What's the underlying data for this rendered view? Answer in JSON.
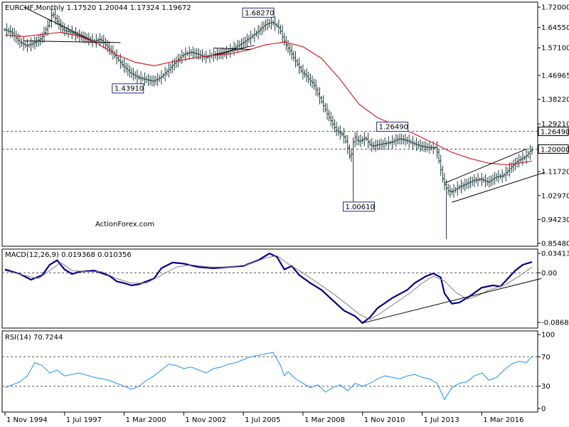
{
  "chart_data": [
    {
      "type": "ohlc",
      "title": "EURCHF,Monthly  1.17520 1.20044 1.17324 1.19672",
      "watermark": "ActionForex.com",
      "ylim": [
        0.8441,
        1.7382
      ],
      "y_ticks": [
        "1.72000",
        "1.64550",
        "1.57100",
        "1.46965",
        "1.38220",
        "1.29210",
        "1.20000",
        "1.11720",
        "1.02970",
        "0.94230",
        "0.85480"
      ],
      "y_tick_values": [
        1.72,
        1.6455,
        1.571,
        1.46965,
        1.3822,
        1.2921,
        1.2,
        1.1172,
        1.0297,
        0.9423,
        0.8548
      ],
      "price_axis_labels": [
        "1.26490",
        "1.20000"
      ],
      "x_ticks": [
        "1 Nov 1994",
        "1 Jul 1997",
        "1 Mar 2000",
        "1 Nov 2002",
        "1 Jul 2005",
        "1 Mar 2008",
        "1 Nov 2010",
        "1 Jul 2013",
        "1 Mar 2016"
      ],
      "x_tick_index": [
        0,
        32,
        64,
        96,
        128,
        160,
        192,
        224,
        256
      ],
      "n_bars": 284,
      "price_series": [
        [
          0,
          1.638
        ],
        [
          4,
          1.628
        ],
        [
          8,
          1.594
        ],
        [
          12,
          1.578
        ],
        [
          16,
          1.588
        ],
        [
          20,
          1.606
        ],
        [
          24,
          1.658
        ],
        [
          26,
          1.7
        ],
        [
          28,
          1.672
        ],
        [
          32,
          1.635
        ],
        [
          36,
          1.628
        ],
        [
          40,
          1.615
        ],
        [
          44,
          1.606
        ],
        [
          48,
          1.595
        ],
        [
          52,
          1.602
        ],
        [
          56,
          1.57
        ],
        [
          60,
          1.538
        ],
        [
          64,
          1.505
        ],
        [
          68,
          1.478
        ],
        [
          72,
          1.462
        ],
        [
          76,
          1.455
        ],
        [
          80,
          1.448
        ],
        [
          84,
          1.462
        ],
        [
          88,
          1.488
        ],
        [
          92,
          1.518
        ],
        [
          96,
          1.545
        ],
        [
          100,
          1.555
        ],
        [
          104,
          1.548
        ],
        [
          108,
          1.536
        ],
        [
          112,
          1.544
        ],
        [
          116,
          1.548
        ],
        [
          120,
          1.556
        ],
        [
          124,
          1.572
        ],
        [
          128,
          1.588
        ],
        [
          132,
          1.608
        ],
        [
          136,
          1.628
        ],
        [
          140,
          1.655
        ],
        [
          144,
          1.665
        ],
        [
          148,
          1.642
        ],
        [
          150,
          1.6
        ],
        [
          152,
          1.575
        ],
        [
          154,
          1.555
        ],
        [
          156,
          1.528
        ],
        [
          158,
          1.505
        ],
        [
          160,
          1.48
        ],
        [
          162,
          1.472
        ],
        [
          164,
          1.452
        ],
        [
          166,
          1.44
        ],
        [
          168,
          1.41
        ],
        [
          170,
          1.38
        ],
        [
          172,
          1.352
        ],
        [
          174,
          1.322
        ],
        [
          176,
          1.298
        ],
        [
          178,
          1.272
        ],
        [
          180,
          1.26
        ],
        [
          182,
          1.252
        ],
        [
          184,
          1.22
        ],
        [
          186,
          1.16
        ],
        [
          188,
          1.248
        ],
        [
          190,
          1.228
        ],
        [
          192,
          1.232
        ],
        [
          194,
          1.242
        ],
        [
          196,
          1.22
        ],
        [
          198,
          1.21
        ],
        [
          200,
          1.215
        ],
        [
          204,
          1.22
        ],
        [
          208,
          1.225
        ],
        [
          212,
          1.238
        ],
        [
          216,
          1.232
        ],
        [
          220,
          1.22
        ],
        [
          224,
          1.21
        ],
        [
          228,
          1.206
        ],
        [
          232,
          1.205
        ],
        [
          236,
          1.076
        ],
        [
          238,
          1.05
        ],
        [
          240,
          1.042
        ],
        [
          244,
          1.06
        ],
        [
          248,
          1.072
        ],
        [
          252,
          1.085
        ],
        [
          256,
          1.09
        ],
        [
          260,
          1.078
        ],
        [
          264,
          1.098
        ],
        [
          268,
          1.102
        ],
        [
          272,
          1.132
        ],
        [
          276,
          1.158
        ],
        [
          280,
          1.172
        ],
        [
          283,
          1.1967
        ]
      ],
      "moving_average": [
        [
          0,
          1.618
        ],
        [
          10,
          1.612
        ],
        [
          20,
          1.62
        ],
        [
          30,
          1.628
        ],
        [
          40,
          1.613
        ],
        [
          50,
          1.585
        ],
        [
          60,
          1.545
        ],
        [
          70,
          1.518
        ],
        [
          80,
          1.505
        ],
        [
          90,
          1.52
        ],
        [
          100,
          1.532
        ],
        [
          110,
          1.542
        ],
        [
          120,
          1.548
        ],
        [
          130,
          1.562
        ],
        [
          140,
          1.582
        ],
        [
          150,
          1.592
        ],
        [
          160,
          1.575
        ],
        [
          170,
          1.532
        ],
        [
          180,
          1.455
        ],
        [
          190,
          1.365
        ],
        [
          200,
          1.315
        ],
        [
          210,
          1.286
        ],
        [
          220,
          1.255
        ],
        [
          230,
          1.222
        ],
        [
          240,
          1.188
        ],
        [
          250,
          1.165
        ],
        [
          260,
          1.148
        ],
        [
          270,
          1.142
        ],
        [
          283,
          1.156
        ]
      ],
      "horizontal_lines": [
        1.2649,
        1.2
      ],
      "annotations": [
        {
          "text": "1.68270",
          "index": 136,
          "value": 1.6827
        },
        {
          "text": "1.43910",
          "index": 66,
          "value": 1.4391
        },
        {
          "text": "1.26490",
          "index": 208,
          "value": 1.2649
        },
        {
          "text": "1.00610",
          "index": 190,
          "value": 1.0061
        }
      ]
    },
    {
      "type": "line",
      "title": "MACD(12,26,9) 0.019368 0.010356",
      "ylim": [
        -0.0968,
        0.0416
      ],
      "y_ticks": [
        "0.034137",
        "0.00",
        "-0.086849"
      ],
      "y_tick_values": [
        0.034137,
        0.0,
        -0.086849
      ],
      "series": [
        {
          "name": "MACD",
          "color": "#00008b",
          "points": [
            [
              0,
              0.006
            ],
            [
              8,
              -0.002
            ],
            [
              14,
              -0.012
            ],
            [
              20,
              -0.004
            ],
            [
              24,
              0.014
            ],
            [
              28,
              0.022
            ],
            [
              32,
              0.006
            ],
            [
              36,
              -0.002
            ],
            [
              40,
              0.002
            ],
            [
              48,
              0.004
            ],
            [
              56,
              -0.005
            ],
            [
              60,
              -0.015
            ],
            [
              64,
              -0.018
            ],
            [
              68,
              -0.022
            ],
            [
              72,
              -0.02
            ],
            [
              80,
              -0.01
            ],
            [
              84,
              0.008
            ],
            [
              90,
              0.018
            ],
            [
              96,
              0.016
            ],
            [
              104,
              0.01
            ],
            [
              112,
              0.008
            ],
            [
              120,
              0.01
            ],
            [
              128,
              0.012
            ],
            [
              136,
              0.022
            ],
            [
              142,
              0.034
            ],
            [
              146,
              0.028
            ],
            [
              150,
              0.006
            ],
            [
              154,
              0.012
            ],
            [
              158,
              -0.004
            ],
            [
              164,
              -0.018
            ],
            [
              170,
              -0.03
            ],
            [
              176,
              -0.048
            ],
            [
              182,
              -0.066
            ],
            [
              188,
              -0.076
            ],
            [
              192,
              -0.088
            ],
            [
              196,
              -0.078
            ],
            [
              200,
              -0.062
            ],
            [
              208,
              -0.044
            ],
            [
              216,
              -0.03
            ],
            [
              220,
              -0.018
            ],
            [
              226,
              -0.006
            ],
            [
              230,
              -0.001
            ],
            [
              234,
              -0.008
            ],
            [
              236,
              -0.036
            ],
            [
              240,
              -0.054
            ],
            [
              244,
              -0.052
            ],
            [
              250,
              -0.04
            ],
            [
              256,
              -0.026
            ],
            [
              262,
              -0.022
            ],
            [
              266,
              -0.024
            ],
            [
              270,
              -0.01
            ],
            [
              274,
              0.004
            ],
            [
              278,
              0.014
            ],
            [
              283,
              0.019
            ]
          ]
        },
        {
          "name": "Signal",
          "color": "#808080",
          "points": [
            [
              0,
              0.004
            ],
            [
              10,
              -0.004
            ],
            [
              18,
              -0.01
            ],
            [
              24,
              0.004
            ],
            [
              30,
              0.018
            ],
            [
              36,
              0.004
            ],
            [
              44,
              0.002
            ],
            [
              52,
              0.002
            ],
            [
              60,
              -0.01
            ],
            [
              68,
              -0.018
            ],
            [
              76,
              -0.018
            ],
            [
              84,
              -0.004
            ],
            [
              92,
              0.01
            ],
            [
              100,
              0.014
            ],
            [
              110,
              0.01
            ],
            [
              120,
              0.01
            ],
            [
              130,
              0.014
            ],
            [
              140,
              0.026
            ],
            [
              146,
              0.03
            ],
            [
              152,
              0.016
            ],
            [
              160,
              0.0
            ],
            [
              168,
              -0.018
            ],
            [
              176,
              -0.036
            ],
            [
              184,
              -0.056
            ],
            [
              190,
              -0.072
            ],
            [
              196,
              -0.082
            ],
            [
              202,
              -0.07
            ],
            [
              210,
              -0.052
            ],
            [
              218,
              -0.034
            ],
            [
              224,
              -0.018
            ],
            [
              230,
              -0.006
            ],
            [
              236,
              -0.014
            ],
            [
              242,
              -0.034
            ],
            [
              248,
              -0.046
            ],
            [
              254,
              -0.04
            ],
            [
              260,
              -0.03
            ],
            [
              268,
              -0.022
            ],
            [
              276,
              -0.006
            ],
            [
              283,
              0.01
            ]
          ]
        }
      ],
      "horizontal_lines": [
        0
      ]
    },
    {
      "type": "line",
      "title": "RSI(14) 70.7244",
      "ylim": [
        -5,
        105
      ],
      "y_ticks": [
        "100",
        "70",
        "30",
        "0"
      ],
      "y_tick_values": [
        100,
        70,
        30,
        0
      ],
      "series": [
        {
          "name": "RSI",
          "color": "#1e90ff",
          "points": [
            [
              0,
              28
            ],
            [
              4,
              32
            ],
            [
              8,
              36
            ],
            [
              12,
              44
            ],
            [
              16,
              62
            ],
            [
              20,
              58
            ],
            [
              24,
              48
            ],
            [
              28,
              52
            ],
            [
              32,
              44
            ],
            [
              40,
              48
            ],
            [
              48,
              42
            ],
            [
              56,
              38
            ],
            [
              60,
              34
            ],
            [
              64,
              30
            ],
            [
              68,
              26
            ],
            [
              72,
              30
            ],
            [
              76,
              38
            ],
            [
              80,
              44
            ],
            [
              84,
              52
            ],
            [
              88,
              60
            ],
            [
              92,
              58
            ],
            [
              96,
              54
            ],
            [
              100,
              56
            ],
            [
              104,
              52
            ],
            [
              108,
              48
            ],
            [
              112,
              54
            ],
            [
              116,
              56
            ],
            [
              120,
              60
            ],
            [
              124,
              62
            ],
            [
              128,
              66
            ],
            [
              132,
              70
            ],
            [
              136,
              72
            ],
            [
              140,
              74
            ],
            [
              144,
              76
            ],
            [
              148,
              58
            ],
            [
              150,
              44
            ],
            [
              152,
              50
            ],
            [
              156,
              40
            ],
            [
              160,
              34
            ],
            [
              164,
              28
            ],
            [
              168,
              32
            ],
            [
              172,
              22
            ],
            [
              176,
              28
            ],
            [
              180,
              32
            ],
            [
              184,
              24
            ],
            [
              188,
              34
            ],
            [
              192,
              30
            ],
            [
              196,
              34
            ],
            [
              200,
              40
            ],
            [
              204,
              44
            ],
            [
              208,
              42
            ],
            [
              212,
              40
            ],
            [
              216,
              44
            ],
            [
              220,
              46
            ],
            [
              224,
              42
            ],
            [
              228,
              40
            ],
            [
              232,
              34
            ],
            [
              236,
              12
            ],
            [
              240,
              28
            ],
            [
              244,
              34
            ],
            [
              248,
              36
            ],
            [
              252,
              44
            ],
            [
              256,
              48
            ],
            [
              260,
              38
            ],
            [
              264,
              42
            ],
            [
              268,
              52
            ],
            [
              272,
              60
            ],
            [
              276,
              64
            ],
            [
              280,
              62
            ],
            [
              283,
              70.7
            ]
          ]
        }
      ],
      "horizontal_lines": [
        70,
        30
      ]
    }
  ]
}
